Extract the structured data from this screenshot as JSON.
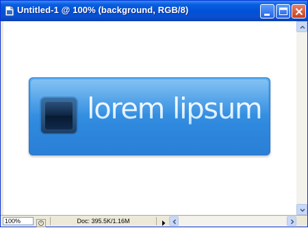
{
  "window": {
    "title": "Untitled-1 @ 100% (background, RGB/8)",
    "colors": {
      "titlebar": "#0051d8",
      "close": "#c8401e"
    }
  },
  "canvas": {
    "logo_text": "lorem lipsum",
    "colors": {
      "button": "#2f89de",
      "icon_square": "#0f2744",
      "text": "#f4faff"
    }
  },
  "status": {
    "zoom": "100%",
    "doc_info": "Doc: 395.5K/1.16M"
  },
  "icons": [
    "document-icon",
    "minimize-icon",
    "maximize-icon",
    "close-icon",
    "scroll-up-icon",
    "scroll-down-icon",
    "status-icon",
    "menu-arrow-icon",
    "scroll-left-icon",
    "scroll-right-icon"
  ]
}
